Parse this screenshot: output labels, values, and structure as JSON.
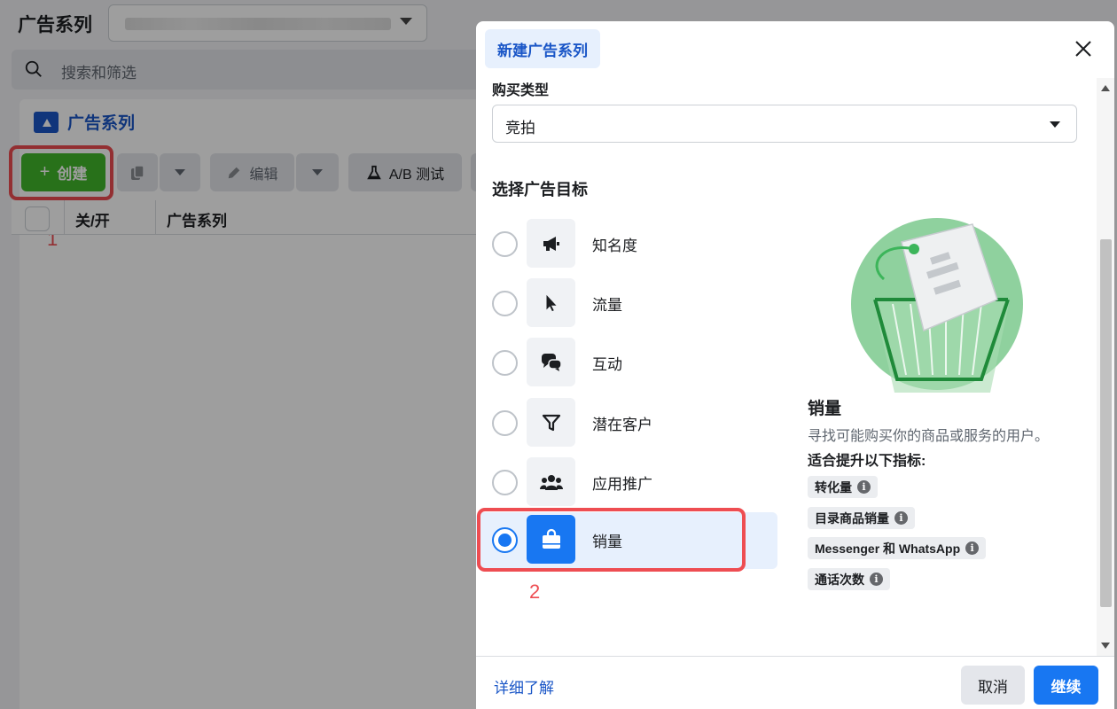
{
  "background": {
    "page_title": "广告系列",
    "search_placeholder": "搜索和筛选",
    "panel_title": "广告系列",
    "toolbar": {
      "create_label": "创建",
      "edit_label": "编辑",
      "ab_test_label": "A/B 测试"
    },
    "table_headers": [
      "关/开",
      "广告系列"
    ],
    "annotation_1": "1"
  },
  "modal": {
    "tab_label": "新建广告系列",
    "purchase_type_label": "购买类型",
    "purchase_type_value": "竞拍",
    "objective_heading": "选择广告目标",
    "objectives": [
      {
        "label": "知名度",
        "icon": "megaphone-icon",
        "selected": false
      },
      {
        "label": "流量",
        "icon": "cursor-icon",
        "selected": false
      },
      {
        "label": "互动",
        "icon": "chat-bubbles-icon",
        "selected": false
      },
      {
        "label": "潜在客户",
        "icon": "funnel-icon",
        "selected": false
      },
      {
        "label": "应用推广",
        "icon": "people-icon",
        "selected": false
      },
      {
        "label": "销量",
        "icon": "shopping-bag-icon",
        "selected": true
      }
    ],
    "annotation_2": "2",
    "detail": {
      "title": "销量",
      "description": "寻找可能购买你的商品或服务的用户。",
      "metrics_heading": "适合提升以下指标:",
      "metrics": [
        "转化量",
        "目录商品销量",
        "Messenger 和 WhatsApp",
        "通话次数"
      ]
    },
    "footer": {
      "learn_more": "详细了解",
      "cancel": "取消",
      "continue": "继续"
    }
  },
  "colors": {
    "primary_blue": "#1877f2",
    "create_green": "#42b72a",
    "highlight_red": "#ee4d52",
    "illustration_green": "#8fd19e"
  }
}
